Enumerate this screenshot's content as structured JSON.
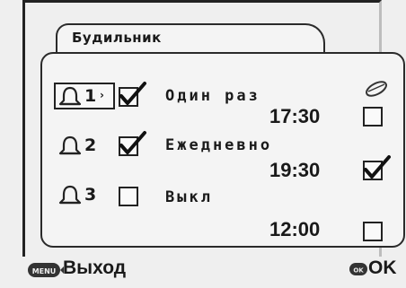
{
  "header": {
    "title": "Будильник"
  },
  "alarms": [
    {
      "number": "1",
      "mode": "Один раз",
      "time": "17:30",
      "enabled": true,
      "sound": false,
      "selected": true
    },
    {
      "number": "2",
      "mode": "Ежедневно",
      "time": "19:30",
      "enabled": true,
      "sound": true,
      "selected": false
    },
    {
      "number": "3",
      "mode": "Выкл",
      "time": "12:00",
      "enabled": false,
      "sound": false,
      "selected": false
    }
  ],
  "column_icon": "sound-icon",
  "footer": {
    "menu_button_label": "MENU",
    "exit_label": "Выход",
    "ok_button_label": "OK",
    "ok_label": "OK"
  }
}
